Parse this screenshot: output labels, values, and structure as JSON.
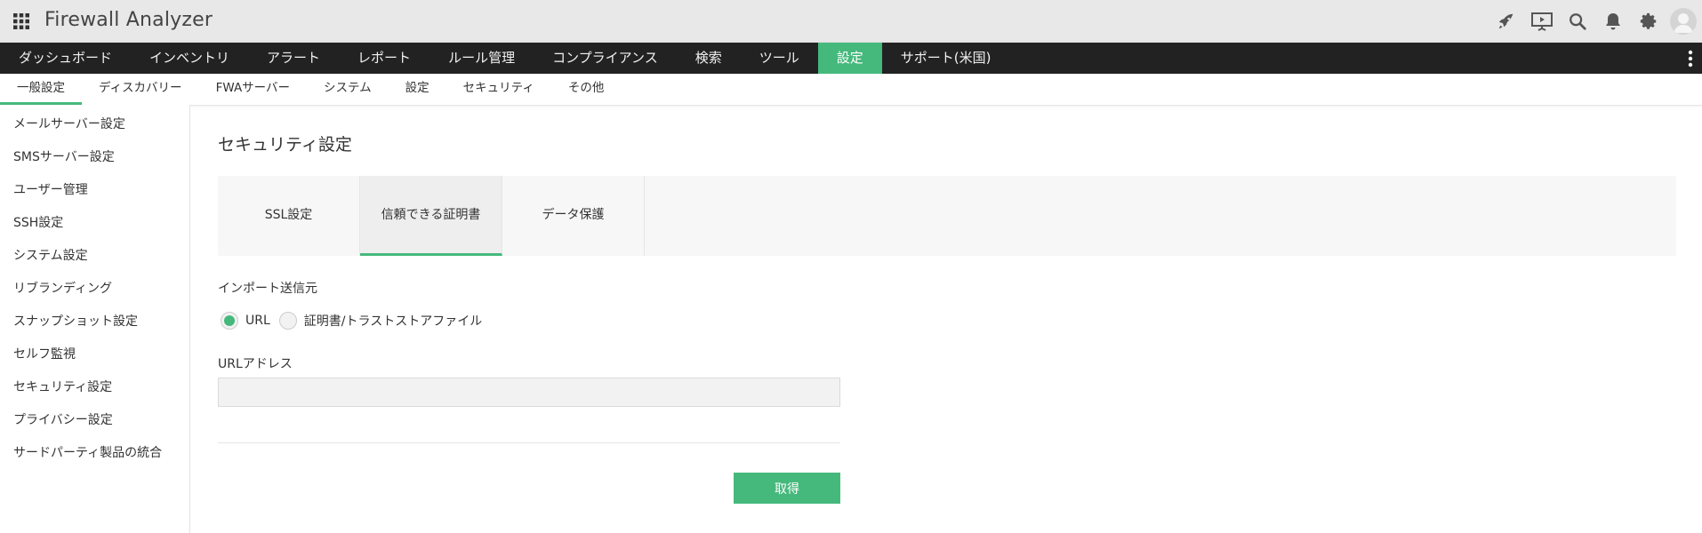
{
  "header": {
    "app_title": "Firewall Analyzer",
    "icons": [
      "apps-grid-icon",
      "rocket-icon",
      "presentation-icon",
      "search-icon",
      "bell-icon",
      "gear-icon",
      "user-avatar-icon"
    ]
  },
  "main_nav": {
    "items": [
      "ダッシュボード",
      "インベントリ",
      "アラート",
      "レポート",
      "ルール管理",
      "コンプライアンス",
      "検索",
      "ツール",
      "設定",
      "サポート(米国)"
    ],
    "active": "設定"
  },
  "sub_nav": {
    "items": [
      "一般設定",
      "ディスカバリー",
      "FWAサーバー",
      "システム",
      "設定",
      "セキュリティ",
      "その他"
    ],
    "active": "一般設定"
  },
  "sidebar": {
    "items": [
      "メールサーバー設定",
      "SMSサーバー設定",
      "ユーザー管理",
      "SSH設定",
      "システム設定",
      "リブランディング",
      "スナップショット設定",
      "セルフ監視",
      "セキュリティ設定",
      "プライバシー設定",
      "サードパーティ製品の統合"
    ]
  },
  "main": {
    "page_title": "セキュリティ設定",
    "tabs": [
      "SSL設定",
      "信頼できる証明書",
      "データ保護"
    ],
    "active_tab": "信頼できる証明書",
    "import_source_label": "インポート送信元",
    "radio_options": [
      "URL",
      "証明書/トラストストアファイル"
    ],
    "radio_selected": "URL",
    "url_label": "URLアドレス",
    "url_value": "",
    "fetch_button": "取得"
  },
  "colors": {
    "accent": "#45b97c",
    "nav_bg": "#222222",
    "header_bg": "#e8e8e8"
  }
}
